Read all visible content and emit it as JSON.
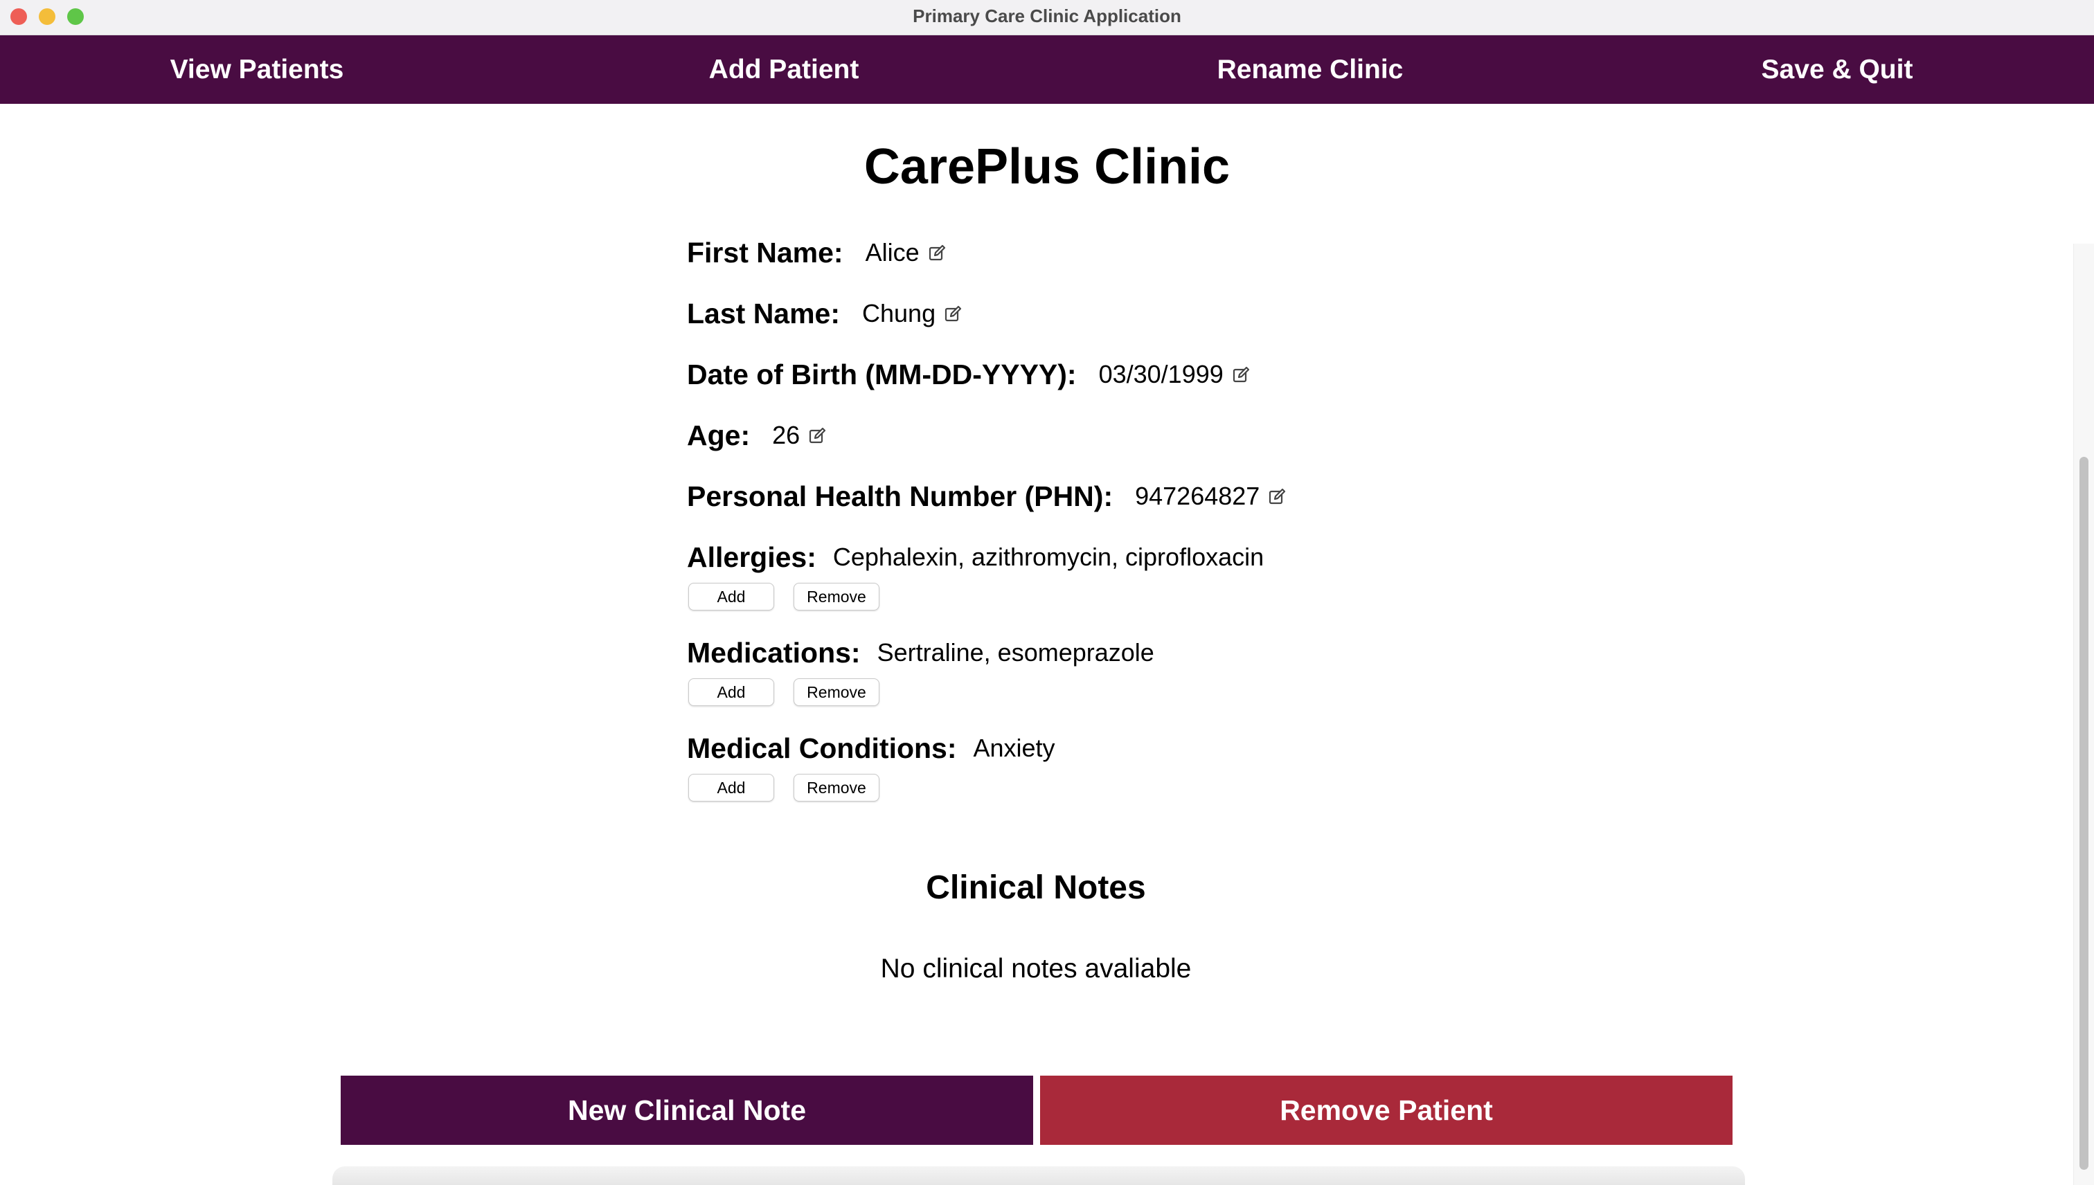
{
  "window": {
    "title": "Primary Care Clinic Application"
  },
  "nav": {
    "view_patients": "View Patients",
    "add_patient": "Add Patient",
    "rename_clinic": "Rename Clinic",
    "save_quit": "Save & Quit"
  },
  "clinic": {
    "name": "CarePlus Clinic"
  },
  "patient": {
    "first_name": {
      "label": "First Name:",
      "value": "Alice"
    },
    "last_name": {
      "label": "Last Name:",
      "value": "Chung"
    },
    "dob": {
      "label": "Date of Birth (MM-DD-YYYY):",
      "value": "03/30/1999"
    },
    "age": {
      "label": "Age:",
      "value": "26"
    },
    "phn": {
      "label": "Personal Health Number (PHN):",
      "value": "947264827"
    },
    "allergies": {
      "label": "Allergies:",
      "value": "Cephalexin, azithromycin, ciprofloxacin"
    },
    "medications": {
      "label": "Medications:",
      "value": "Sertraline, esomeprazole"
    },
    "conditions": {
      "label": "Medical Conditions:",
      "value": "Anxiety"
    }
  },
  "buttons": {
    "add": "Add",
    "remove": "Remove"
  },
  "notes": {
    "title": "Clinical Notes",
    "empty": "No clinical notes avaliable"
  },
  "actions": {
    "new_note": "New Clinical Note",
    "remove_patient": "Remove Patient"
  },
  "colors": {
    "nav_bg": "#490c42",
    "new_note_bg": "#490c42",
    "remove_bg": "#a9293a"
  },
  "icons": {
    "edit": "edit-pencil-icon"
  }
}
